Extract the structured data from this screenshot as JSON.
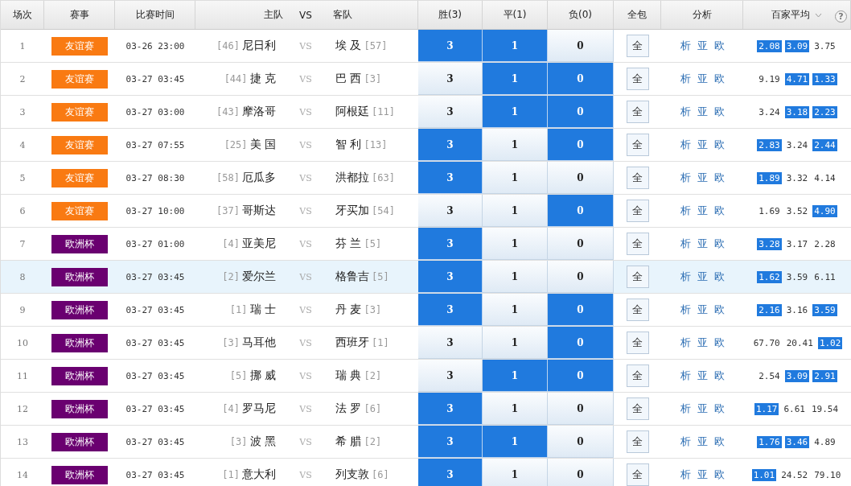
{
  "header": {
    "columns": [
      "场次",
      "赛事",
      "比赛时间",
      "主队",
      "VS",
      "客队",
      "胜(3)",
      "平(1)",
      "负(0)",
      "全包",
      "分析",
      "百家平均"
    ],
    "help": "?"
  },
  "rows": [
    {
      "no": "1",
      "league": "友谊赛",
      "color": "#f97a12",
      "time": "03-26 23:00",
      "home_rank": "[46]",
      "home": "尼日利",
      "vs": "VS",
      "away": "埃 及",
      "away_rank": "[57]",
      "picks": [
        {
          "label": "3",
          "selected": true
        },
        {
          "label": "1",
          "selected": true
        },
        {
          "label": "0",
          "selected": false
        }
      ],
      "all": "全",
      "links": [
        "析",
        "亚",
        "欧"
      ],
      "odds": [
        {
          "value": "2.08",
          "selected": true
        },
        {
          "value": "3.09",
          "selected": true
        },
        {
          "value": "3.75",
          "selected": false
        }
      ],
      "highlighted": false
    },
    {
      "no": "2",
      "league": "友谊赛",
      "color": "#f97a12",
      "time": "03-27 03:45",
      "home_rank": "[44]",
      "home": "捷 克",
      "vs": "VS",
      "away": "巴 西",
      "away_rank": "[3]",
      "picks": [
        {
          "label": "3",
          "selected": false
        },
        {
          "label": "1",
          "selected": true
        },
        {
          "label": "0",
          "selected": true
        }
      ],
      "all": "全",
      "links": [
        "析",
        "亚",
        "欧"
      ],
      "odds": [
        {
          "value": "9.19",
          "selected": false
        },
        {
          "value": "4.71",
          "selected": true
        },
        {
          "value": "1.33",
          "selected": true
        }
      ],
      "highlighted": false
    },
    {
      "no": "3",
      "league": "友谊赛",
      "color": "#f97a12",
      "time": "03-27 03:00",
      "home_rank": "[43]",
      "home": "摩洛哥",
      "vs": "VS",
      "away": "阿根廷",
      "away_rank": "[11]",
      "picks": [
        {
          "label": "3",
          "selected": false
        },
        {
          "label": "1",
          "selected": true
        },
        {
          "label": "0",
          "selected": true
        }
      ],
      "all": "全",
      "links": [
        "析",
        "亚",
        "欧"
      ],
      "odds": [
        {
          "value": "3.24",
          "selected": false
        },
        {
          "value": "3.18",
          "selected": true
        },
        {
          "value": "2.23",
          "selected": true
        }
      ],
      "highlighted": false
    },
    {
      "no": "4",
      "league": "友谊赛",
      "color": "#f97a12",
      "time": "03-27 07:55",
      "home_rank": "[25]",
      "home": "美 国",
      "vs": "VS",
      "away": "智 利",
      "away_rank": "[13]",
      "picks": [
        {
          "label": "3",
          "selected": true
        },
        {
          "label": "1",
          "selected": false
        },
        {
          "label": "0",
          "selected": true
        }
      ],
      "all": "全",
      "links": [
        "析",
        "亚",
        "欧"
      ],
      "odds": [
        {
          "value": "2.83",
          "selected": true
        },
        {
          "value": "3.24",
          "selected": false
        },
        {
          "value": "2.44",
          "selected": true
        }
      ],
      "highlighted": false
    },
    {
      "no": "5",
      "league": "友谊赛",
      "color": "#f97a12",
      "time": "03-27 08:30",
      "home_rank": "[58]",
      "home": "厄瓜多",
      "vs": "VS",
      "away": "洪都拉",
      "away_rank": "[63]",
      "picks": [
        {
          "label": "3",
          "selected": true
        },
        {
          "label": "1",
          "selected": false
        },
        {
          "label": "0",
          "selected": false
        }
      ],
      "all": "全",
      "links": [
        "析",
        "亚",
        "欧"
      ],
      "odds": [
        {
          "value": "1.89",
          "selected": true
        },
        {
          "value": "3.32",
          "selected": false
        },
        {
          "value": "4.14",
          "selected": false
        }
      ],
      "highlighted": false
    },
    {
      "no": "6",
      "league": "友谊赛",
      "color": "#f97a12",
      "time": "03-27 10:00",
      "home_rank": "[37]",
      "home": "哥斯达",
      "vs": "VS",
      "away": "牙买加",
      "away_rank": "[54]",
      "picks": [
        {
          "label": "3",
          "selected": false
        },
        {
          "label": "1",
          "selected": false
        },
        {
          "label": "0",
          "selected": true
        }
      ],
      "all": "全",
      "links": [
        "析",
        "亚",
        "欧"
      ],
      "odds": [
        {
          "value": "1.69",
          "selected": false
        },
        {
          "value": "3.52",
          "selected": false
        },
        {
          "value": "4.90",
          "selected": true
        }
      ],
      "highlighted": false
    },
    {
      "no": "7",
      "league": "欧洲杯",
      "color": "#6a0070",
      "time": "03-27 01:00",
      "home_rank": "[4]",
      "home": "亚美尼",
      "vs": "VS",
      "away": "芬 兰",
      "away_rank": "[5]",
      "picks": [
        {
          "label": "3",
          "selected": true
        },
        {
          "label": "1",
          "selected": false
        },
        {
          "label": "0",
          "selected": false
        }
      ],
      "all": "全",
      "links": [
        "析",
        "亚",
        "欧"
      ],
      "odds": [
        {
          "value": "3.28",
          "selected": true
        },
        {
          "value": "3.17",
          "selected": false
        },
        {
          "value": "2.28",
          "selected": false
        }
      ],
      "highlighted": false
    },
    {
      "no": "8",
      "league": "欧洲杯",
      "color": "#6a0070",
      "time": "03-27 03:45",
      "home_rank": "[2]",
      "home": "爱尔兰",
      "vs": "VS",
      "away": "格鲁吉",
      "away_rank": "[5]",
      "picks": [
        {
          "label": "3",
          "selected": true
        },
        {
          "label": "1",
          "selected": false
        },
        {
          "label": "0",
          "selected": false
        }
      ],
      "all": "全",
      "links": [
        "析",
        "亚",
        "欧"
      ],
      "odds": [
        {
          "value": "1.62",
          "selected": true
        },
        {
          "value": "3.59",
          "selected": false
        },
        {
          "value": "6.11",
          "selected": false
        }
      ],
      "highlighted": true
    },
    {
      "no": "9",
      "league": "欧洲杯",
      "color": "#6a0070",
      "time": "03-27 03:45",
      "home_rank": "[1]",
      "home": "瑞 士",
      "vs": "VS",
      "away": "丹 麦",
      "away_rank": "[3]",
      "picks": [
        {
          "label": "3",
          "selected": true
        },
        {
          "label": "1",
          "selected": false
        },
        {
          "label": "0",
          "selected": true
        }
      ],
      "all": "全",
      "links": [
        "析",
        "亚",
        "欧"
      ],
      "odds": [
        {
          "value": "2.16",
          "selected": true
        },
        {
          "value": "3.16",
          "selected": false
        },
        {
          "value": "3.59",
          "selected": true
        }
      ],
      "highlighted": false
    },
    {
      "no": "10",
      "league": "欧洲杯",
      "color": "#6a0070",
      "time": "03-27 03:45",
      "home_rank": "[3]",
      "home": "马耳他",
      "vs": "VS",
      "away": "西班牙",
      "away_rank": "[1]",
      "picks": [
        {
          "label": "3",
          "selected": false
        },
        {
          "label": "1",
          "selected": false
        },
        {
          "label": "0",
          "selected": true
        }
      ],
      "all": "全",
      "links": [
        "析",
        "亚",
        "欧"
      ],
      "odds": [
        {
          "value": "67.70",
          "selected": false
        },
        {
          "value": "20.41",
          "selected": false
        },
        {
          "value": "1.02",
          "selected": true
        }
      ],
      "highlighted": false
    },
    {
      "no": "11",
      "league": "欧洲杯",
      "color": "#6a0070",
      "time": "03-27 03:45",
      "home_rank": "[5]",
      "home": "挪 威",
      "vs": "VS",
      "away": "瑞 典",
      "away_rank": "[2]",
      "picks": [
        {
          "label": "3",
          "selected": false
        },
        {
          "label": "1",
          "selected": true
        },
        {
          "label": "0",
          "selected": true
        }
      ],
      "all": "全",
      "links": [
        "析",
        "亚",
        "欧"
      ],
      "odds": [
        {
          "value": "2.54",
          "selected": false
        },
        {
          "value": "3.09",
          "selected": true
        },
        {
          "value": "2.91",
          "selected": true
        }
      ],
      "highlighted": false
    },
    {
      "no": "12",
      "league": "欧洲杯",
      "color": "#6a0070",
      "time": "03-27 03:45",
      "home_rank": "[4]",
      "home": "罗马尼",
      "vs": "VS",
      "away": "法 罗",
      "away_rank": "[6]",
      "picks": [
        {
          "label": "3",
          "selected": true
        },
        {
          "label": "1",
          "selected": false
        },
        {
          "label": "0",
          "selected": false
        }
      ],
      "all": "全",
      "links": [
        "析",
        "亚",
        "欧"
      ],
      "odds": [
        {
          "value": "1.17",
          "selected": true
        },
        {
          "value": "6.61",
          "selected": false
        },
        {
          "value": "19.54",
          "selected": false
        }
      ],
      "highlighted": false
    },
    {
      "no": "13",
      "league": "欧洲杯",
      "color": "#6a0070",
      "time": "03-27 03:45",
      "home_rank": "[3]",
      "home": "波 黑",
      "vs": "VS",
      "away": "希 腊",
      "away_rank": "[2]",
      "picks": [
        {
          "label": "3",
          "selected": true
        },
        {
          "label": "1",
          "selected": true
        },
        {
          "label": "0",
          "selected": false
        }
      ],
      "all": "全",
      "links": [
        "析",
        "亚",
        "欧"
      ],
      "odds": [
        {
          "value": "1.76",
          "selected": true
        },
        {
          "value": "3.46",
          "selected": true
        },
        {
          "value": "4.89",
          "selected": false
        }
      ],
      "highlighted": false
    },
    {
      "no": "14",
      "league": "欧洲杯",
      "color": "#6a0070",
      "time": "03-27 03:45",
      "home_rank": "[1]",
      "home": "意大利",
      "vs": "VS",
      "away": "列支敦",
      "away_rank": "[6]",
      "picks": [
        {
          "label": "3",
          "selected": true
        },
        {
          "label": "1",
          "selected": false
        },
        {
          "label": "0",
          "selected": false
        }
      ],
      "all": "全",
      "links": [
        "析",
        "亚",
        "欧"
      ],
      "odds": [
        {
          "value": "1.01",
          "selected": true
        },
        {
          "value": "24.52",
          "selected": false
        },
        {
          "value": "79.10",
          "selected": false
        }
      ],
      "highlighted": false
    }
  ]
}
